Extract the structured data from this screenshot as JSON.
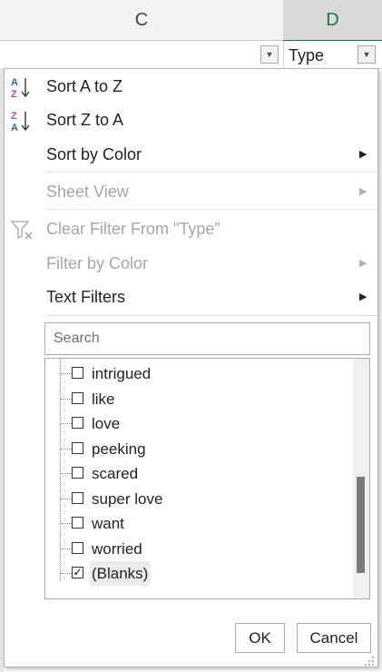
{
  "columns": {
    "c": "C",
    "d": "D"
  },
  "cell": {
    "header_text": "Type"
  },
  "menu": {
    "sort_az": "Sort A to Z",
    "sort_za": "Sort Z to A",
    "sort_by_color": "Sort by Color",
    "sheet_view": "Sheet View",
    "clear_filter": "Clear Filter From \"Type\"",
    "filter_by_color": "Filter by Color",
    "text_filters": "Text Filters"
  },
  "search": {
    "placeholder": "Search"
  },
  "values": [
    {
      "label": "intrigued",
      "checked": false
    },
    {
      "label": "like",
      "checked": false
    },
    {
      "label": "love",
      "checked": false
    },
    {
      "label": "peeking",
      "checked": false
    },
    {
      "label": "scared",
      "checked": false
    },
    {
      "label": "super love",
      "checked": false
    },
    {
      "label": "want",
      "checked": false
    },
    {
      "label": "worried",
      "checked": false
    },
    {
      "label": "(Blanks)",
      "checked": true
    }
  ],
  "buttons": {
    "ok": "OK",
    "cancel": "Cancel"
  },
  "colors": {
    "excel_green": "#217346",
    "sort_a": "#2f66b3",
    "sort_z": "#9b4fa9"
  }
}
